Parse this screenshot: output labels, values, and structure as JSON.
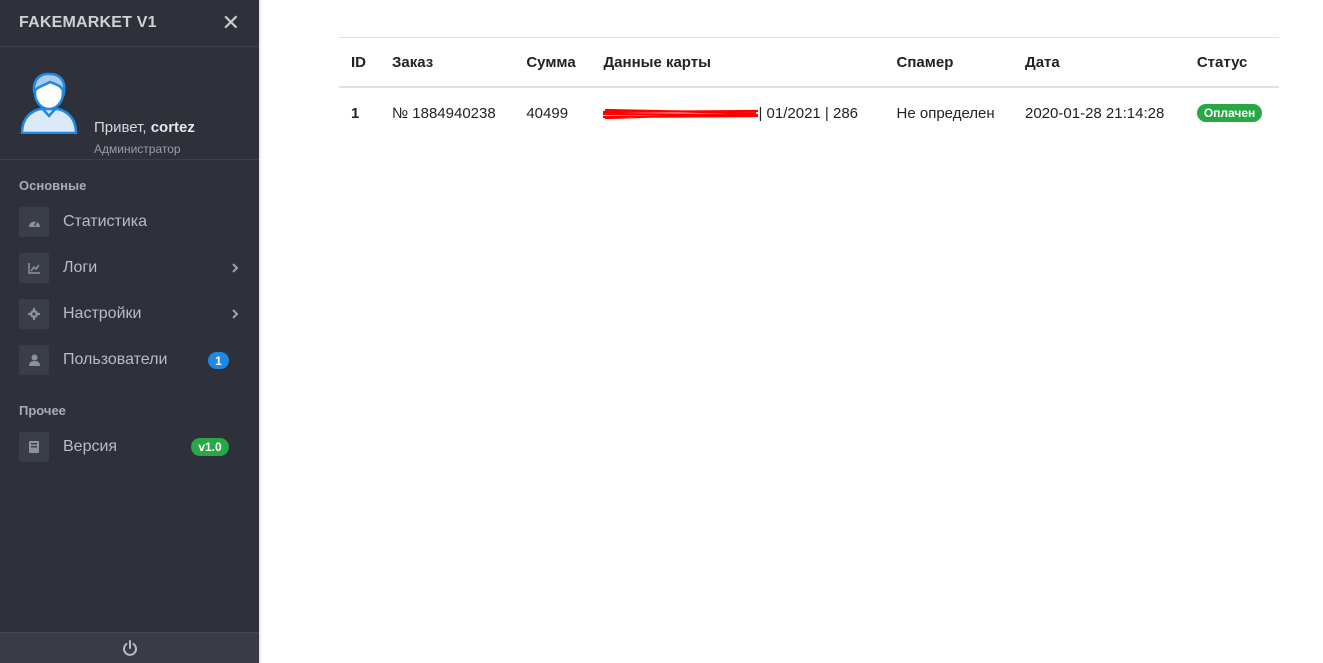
{
  "sidebar": {
    "brand": "FAKEMARKET V1",
    "close_icon": "close-icon",
    "profile": {
      "greeting": "Привет,",
      "username": "cortez",
      "role": "Администратор"
    },
    "sections": [
      {
        "title": "Основные",
        "items": [
          {
            "label": "Статистика",
            "icon": "dashboard-icon"
          },
          {
            "label": "Логи",
            "icon": "chart-icon",
            "has_submenu": true
          },
          {
            "label": "Настройки",
            "icon": "gear-icon",
            "has_submenu": true
          },
          {
            "label": "Пользователи",
            "icon": "user-icon",
            "badge": "1"
          }
        ]
      },
      {
        "title": "Прочее",
        "items": [
          {
            "label": "Версия",
            "icon": "book-icon",
            "badge": "v1.0"
          }
        ]
      }
    ],
    "footer_icon": "power-icon"
  },
  "table": {
    "columns": [
      "ID",
      "Заказ",
      "Сумма",
      "Данные карты",
      "Спамер",
      "Дата",
      "Статус"
    ],
    "rows": [
      {
        "id": "1",
        "order": "№ 1884940238",
        "sum": "40499",
        "card_tail": "| 01/2021 | 286",
        "spammer": "Не определен",
        "date": "2020-01-28 21:14:28",
        "status": "Оплачен"
      }
    ]
  },
  "colors": {
    "sidebar_bg": "#2e3139",
    "badge_blue": "#1e88e5",
    "badge_green": "#28a745",
    "redaction": "#ff0000"
  }
}
